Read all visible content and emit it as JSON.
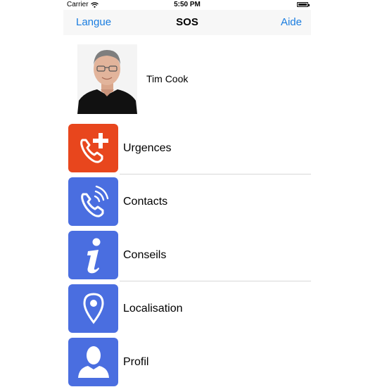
{
  "status_bar": {
    "carrier": "Carrier",
    "time": "5:50 PM"
  },
  "nav": {
    "left_label": "Langue",
    "title": "SOS",
    "right_label": "Aide"
  },
  "profile": {
    "name": "Tim Cook"
  },
  "menu": [
    {
      "label": "Urgences",
      "icon": "phone-plus-icon",
      "color": "#e8461d"
    },
    {
      "label": "Contacts",
      "icon": "phone-call-icon",
      "color": "#4a6ee0"
    },
    {
      "label": "Conseils",
      "icon": "info-icon",
      "color": "#4a6ee0"
    },
    {
      "label": "Localisation",
      "icon": "location-pin-icon",
      "color": "#4a6ee0"
    },
    {
      "label": "Profil",
      "icon": "user-icon",
      "color": "#4a6ee0"
    }
  ],
  "colors": {
    "accent": "#1a7de0",
    "urgent": "#e8461d",
    "tile_blue": "#4a6ee0"
  }
}
